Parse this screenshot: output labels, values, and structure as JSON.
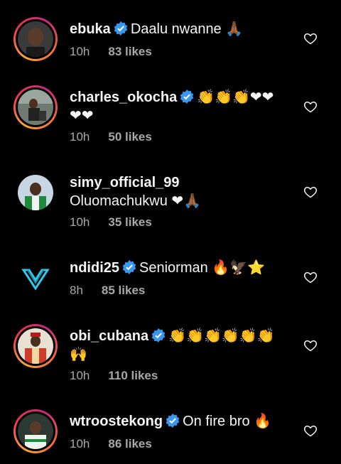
{
  "colors": {
    "background": "#000000",
    "text": "#f5f5f5",
    "muted": "#a8a8a8",
    "verified": "#3897f0"
  },
  "comments": [
    {
      "username": "ebuka",
      "verified": true,
      "text": "Daalu nwanne 🙏🏾",
      "time": "10h",
      "likes": "83 likes",
      "avatar": "avatar-ebuka"
    },
    {
      "username": "charles_okocha",
      "verified": true,
      "text": "👏👏👏❤❤",
      "text2": "❤❤",
      "time": "10h",
      "likes": "50 likes",
      "avatar": "avatar-charles"
    },
    {
      "username": "simy_official_99",
      "verified": false,
      "text": "Oluomachukwu ❤🙏🏾",
      "time": "10h",
      "likes": "35 likes",
      "avatar": "avatar-simy"
    },
    {
      "username": "ndidi25",
      "verified": true,
      "text": "Seniorman 🔥🦅⭐",
      "time": "8h",
      "likes": "85 likes",
      "avatar": "avatar-ndidi"
    },
    {
      "username": "obi_cubana",
      "verified": true,
      "text": "👏👏👏👏👏👏",
      "text2": "🙌",
      "time": "10h",
      "likes": "110 likes",
      "avatar": "avatar-obi"
    },
    {
      "username": "wtroostekong",
      "verified": true,
      "text": "On fire bro 🔥",
      "time": "10h",
      "likes": "86 likes",
      "avatar": "avatar-troost"
    }
  ]
}
